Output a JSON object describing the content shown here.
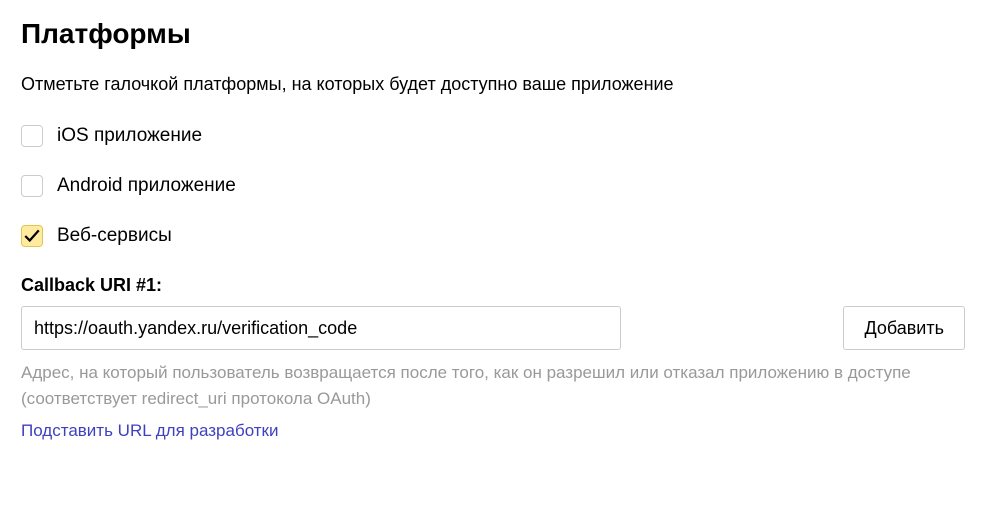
{
  "heading": "Платформы",
  "subtext": "Отметьте галочкой платформы, на которых будет доступно ваше приложение",
  "platforms": {
    "ios": {
      "label": "iOS приложение",
      "checked": false
    },
    "android": {
      "label": "Android приложение",
      "checked": false
    },
    "web": {
      "label": "Веб-сервисы",
      "checked": true
    }
  },
  "callback": {
    "label": "Callback URI #1:",
    "value": "https://oauth.yandex.ru/verification_code",
    "add_button": "Добавить",
    "help_text": "Адрес, на который пользователь возвращается после того, как он разрешил или отказал приложению в доступе (соответствует redirect_uri протокола OAuth)",
    "dev_link": "Подставить URL для разработки"
  }
}
